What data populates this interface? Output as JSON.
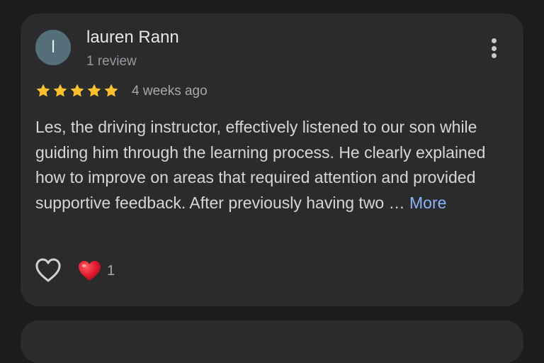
{
  "review": {
    "avatar_letter": "l",
    "author": "lauren Rann",
    "review_count": "1 review",
    "rating": 5,
    "time_ago": "4 weeks ago",
    "text": "Les, the driving instructor, effectively listened to our son while guiding him through the learning process. He clearly explained how to improve on areas that required attention and provided supportive feedback. After previously having two …",
    "more_label": "More",
    "reaction_count": "1",
    "colors": {
      "star": "#fbc02d",
      "more_link": "#8ab4f8",
      "heart": "#e0192e",
      "avatar": "#546e7a"
    },
    "icons": [
      "more-vertical-icon",
      "star-icon",
      "heart-outline-icon",
      "red-heart-icon"
    ]
  }
}
